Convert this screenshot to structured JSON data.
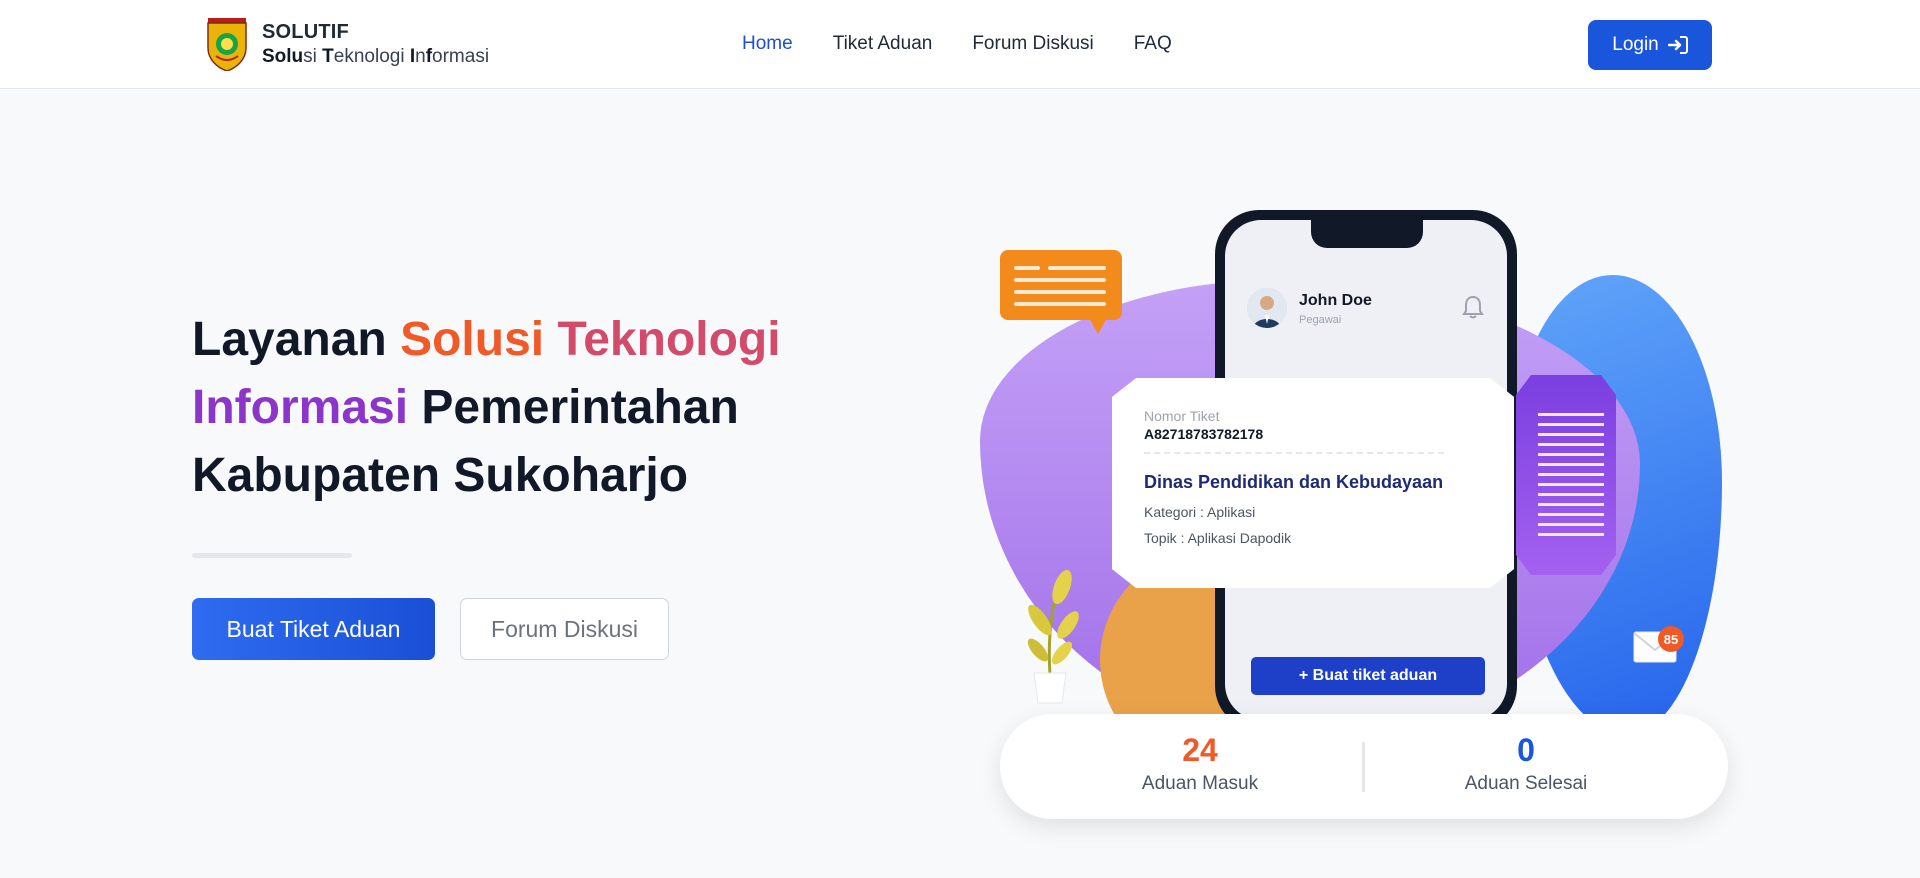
{
  "brand": {
    "name": "SOLUTIF",
    "subtitle_parts": [
      {
        "text": "Solu",
        "bold": true
      },
      {
        "text": "si ",
        "bold": false
      },
      {
        "text": "T",
        "bold": true
      },
      {
        "text": "eknologi ",
        "bold": false
      },
      {
        "text": "I",
        "bold": true
      },
      {
        "text": "n",
        "bold": false
      },
      {
        "text": "f",
        "bold": true
      },
      {
        "text": "ormasi",
        "bold": false
      }
    ]
  },
  "nav": {
    "items": [
      {
        "label": "Home",
        "active": true
      },
      {
        "label": "Tiket Aduan",
        "active": false
      },
      {
        "label": "Forum Diskusi",
        "active": false
      },
      {
        "label": "FAQ",
        "active": false
      }
    ],
    "login_label": "Login"
  },
  "hero": {
    "title_part1": "Layanan ",
    "title_highlight1": "Solusi ",
    "title_highlight2": "Teknologi",
    "title_highlight3": "Informasi",
    "title_part2": " Pemerintahan Kabupaten Sukoharjo",
    "primary_button": "Buat Tiket Aduan",
    "secondary_button": "Forum Diskusi"
  },
  "illustration": {
    "profile_name": "John Doe",
    "profile_role": "Pegawai",
    "ticket_label": "Nomor Tiket",
    "ticket_number": "A82718783782178",
    "department": "Dinas Pendidikan dan Kebudayaan",
    "category": "Kategori : Aplikasi",
    "topic": "Topik : Aplikasi Dapodik",
    "phone_button": "+ Buat tiket aduan",
    "mail_badge": "85"
  },
  "stats": [
    {
      "value": "24",
      "label": "Aduan Masuk"
    },
    {
      "value": "0",
      "label": "Aduan Selesai"
    }
  ],
  "colors": {
    "primary": "#1a56db",
    "accent_orange": "#f05a28",
    "accent_purple": "#8b35c9"
  }
}
